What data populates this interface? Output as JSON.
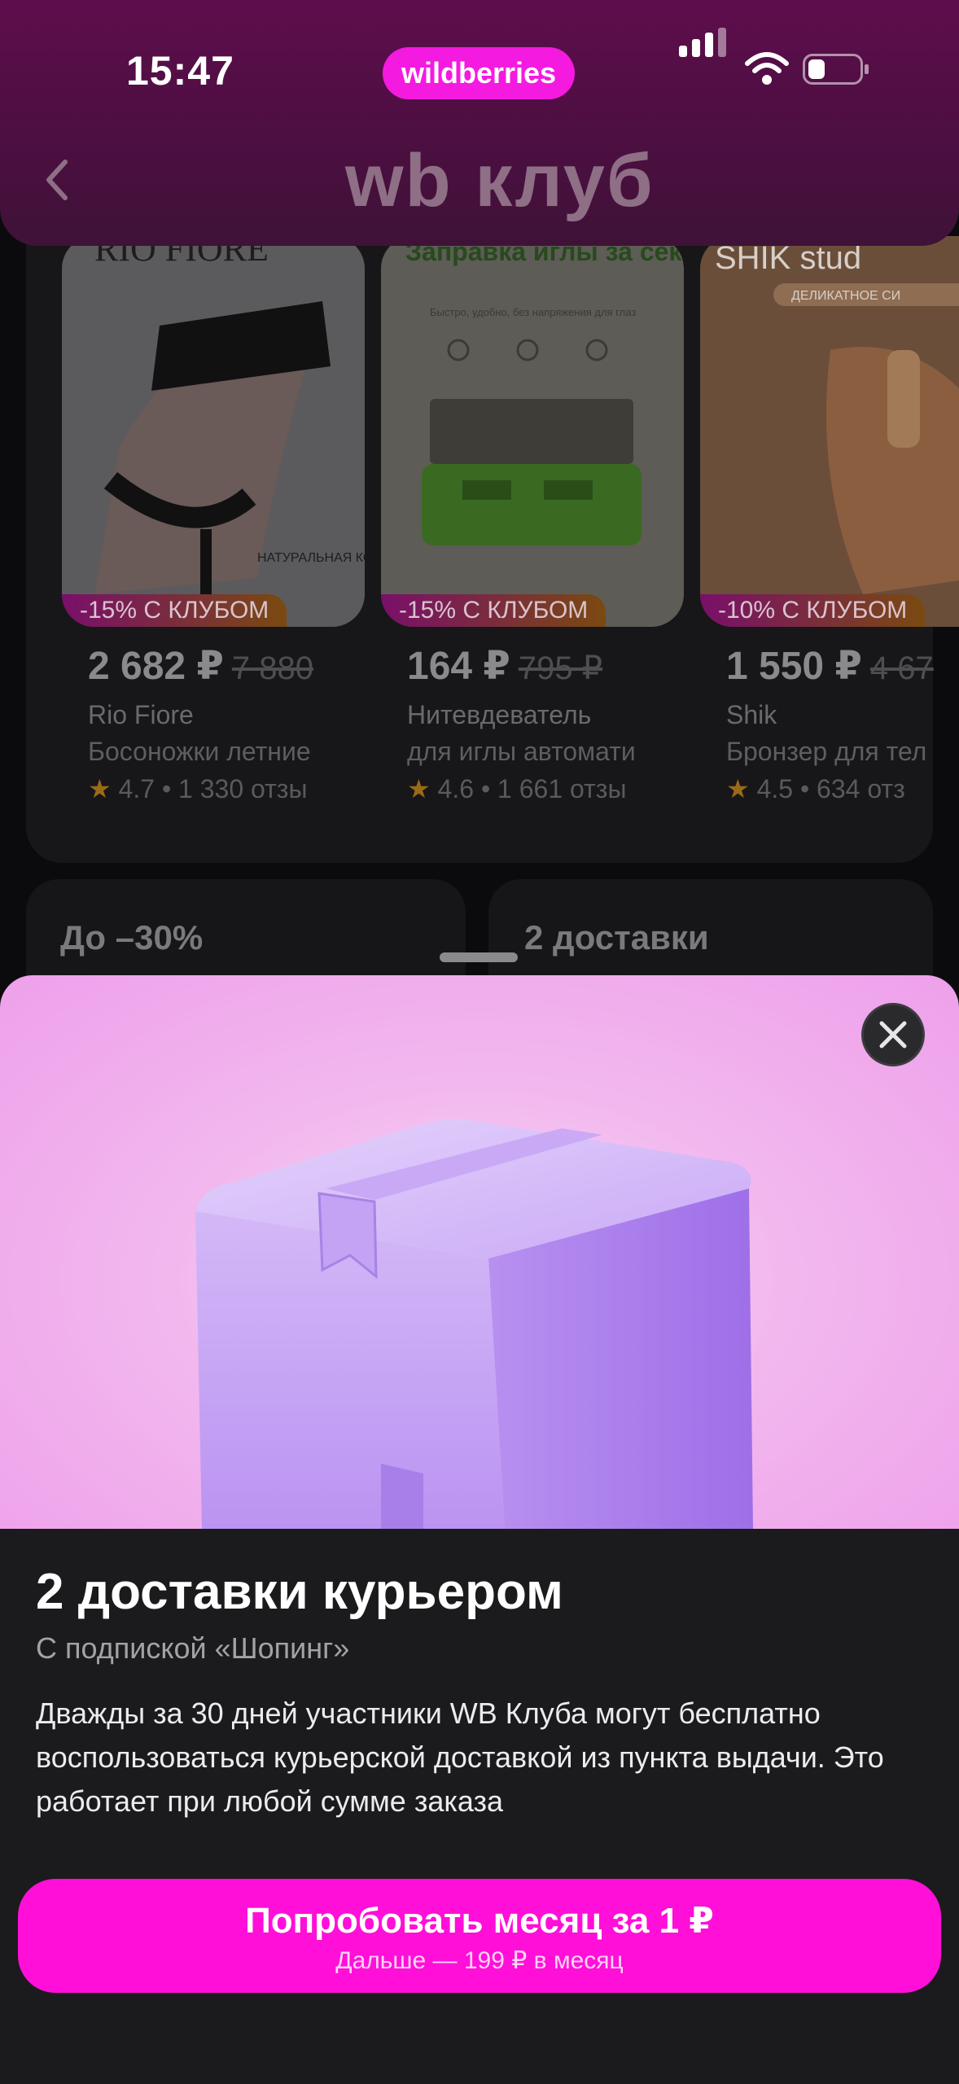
{
  "status_bar": {
    "time": "15:47",
    "center_label": "wildberries"
  },
  "header": {
    "logo_text": "wb клуб"
  },
  "products": [
    {
      "badge": "-15% С КЛУБОМ",
      "price": "2 682 ₽",
      "old_price": "7 880",
      "brand": "Rio Fiore",
      "name": "Босоножки летние",
      "rating": "4.7",
      "reviews": "1 330 отзы",
      "image_text": "RIO FIORE",
      "image_note": "НАТУРАЛЬНАЯ КОЖА"
    },
    {
      "badge": "-15% С КЛУБОМ",
      "price": "164 ₽",
      "old_price": "795 ₽",
      "brand": "Нитевдеватель",
      "name": "для иглы автомати",
      "rating": "4.6",
      "reviews": "1 661 отзы",
      "image_text": "Заправка иглы за секунды",
      "image_note": "Быстро, удобно, без напряжения для глаз"
    },
    {
      "badge": "-10% С КЛУБОМ",
      "price": "1 550 ₽",
      "old_price": "4 67",
      "brand": "Shik",
      "name": "Бронзер для тел",
      "rating": "4.5",
      "reviews": "634 отз",
      "image_text": "SHIK stud",
      "image_note": "ДЕЛИКАТНОЕ СИ"
    }
  ],
  "bottom_cards": [
    {
      "title": "До –30%"
    },
    {
      "title": "2 доставки"
    }
  ],
  "sheet": {
    "title": "2 доставки курьером",
    "subtitle": "С подпиской «Шопинг»",
    "description": "Дважды за 30 дней участники WB Клуба могут бесплатно воспользоваться курьерской доставкой из пункта выдачи. Это работает при любой сумме заказа",
    "cta_label": "Попробовать месяц за 1 ₽",
    "cta_sublabel": "Дальше — 199 ₽ в месяц"
  },
  "colors": {
    "accent": "#ff0fd8",
    "header": "#5e0d4c",
    "hero": "#f2b8ee"
  }
}
